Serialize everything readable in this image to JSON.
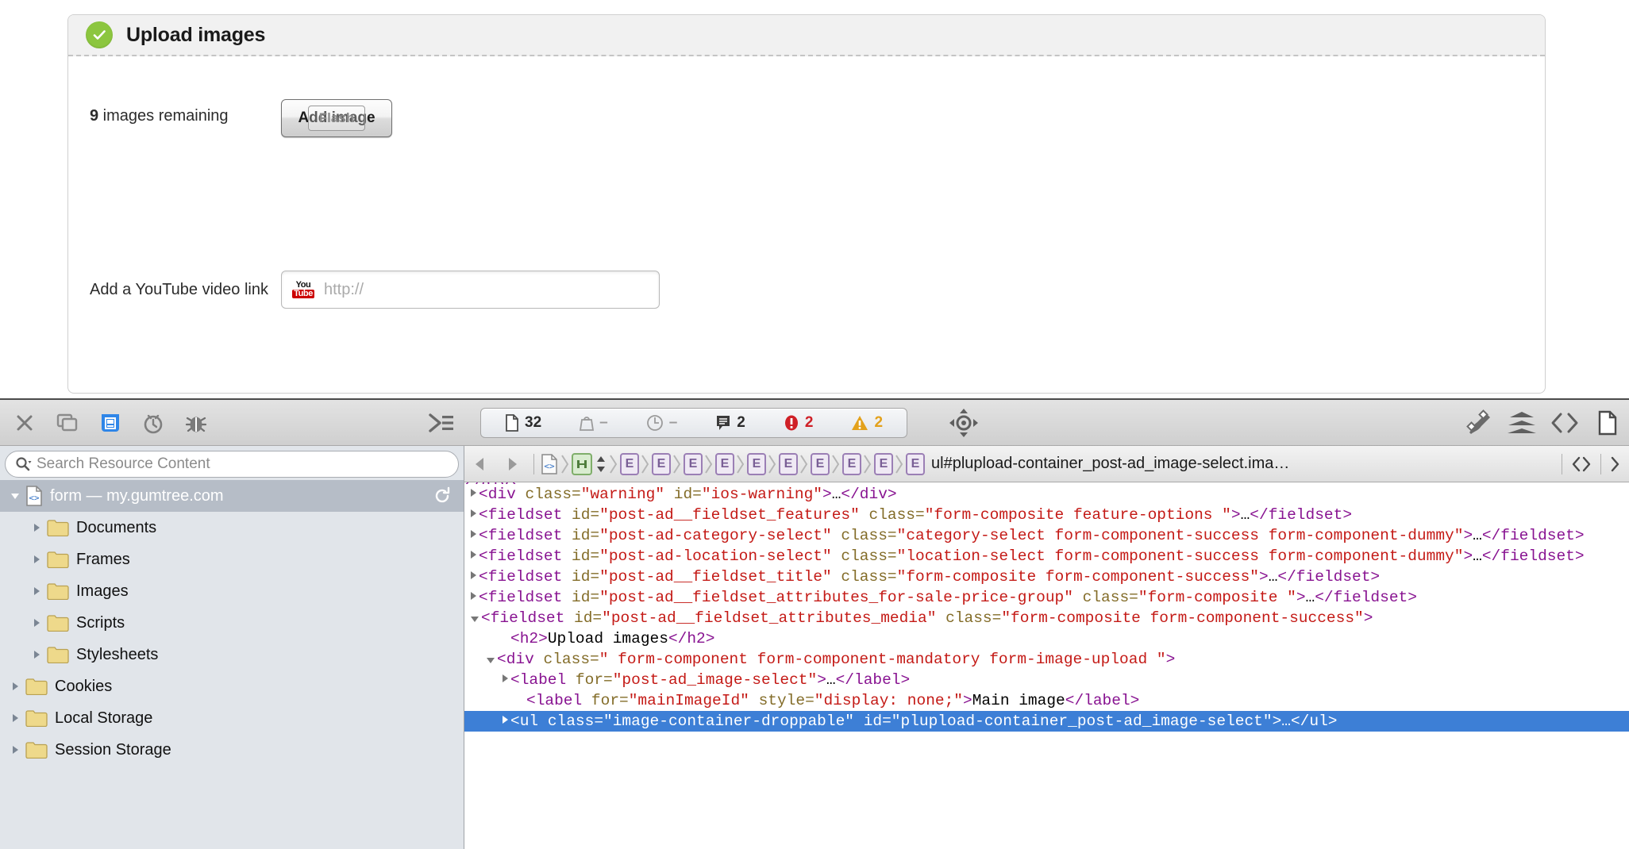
{
  "page": {
    "panel": {
      "title": "Upload images",
      "status_icon": "check-circle-icon",
      "status_color": "#8cc63f",
      "remaining_count": "9",
      "remaining_text": " images remaining",
      "add_image_label": "Add image",
      "flash_overlay_label": "Flash",
      "youtube_label": "Add a YouTube video link",
      "youtube_logo_top": "You",
      "youtube_logo_bottom": "Tube",
      "youtube_placeholder": "http://"
    }
  },
  "devtools": {
    "toolbar": {
      "left_icons": [
        {
          "name": "close-icon",
          "label": "Close"
        },
        {
          "name": "dock-window-icon",
          "label": "Undock"
        },
        {
          "name": "resources-panel-icon",
          "label": "Resources"
        },
        {
          "name": "timeline-clock-icon",
          "label": "Timeline"
        },
        {
          "name": "debugger-bug-icon",
          "label": "Debugger"
        }
      ],
      "console_toggle_icon": "console-prompt-icon",
      "stats": [
        {
          "name": "resource-count",
          "icon": "document-icon",
          "value": "32"
        },
        {
          "name": "resource-size",
          "icon": "weight-icon",
          "value": "–"
        },
        {
          "name": "load-time",
          "icon": "clock-icon",
          "value": "–"
        },
        {
          "name": "console-log-count",
          "icon": "message-icon",
          "value": "2"
        },
        {
          "name": "error-count",
          "icon": "error-icon",
          "value": "2",
          "color": "#cf2027"
        },
        {
          "name": "warning-count",
          "icon": "warning-icon",
          "value": "2",
          "color": "#e3a11b"
        }
      ],
      "right_icons": [
        {
          "name": "inspect-crosshair-icon",
          "label": "Inspect element"
        },
        {
          "name": "styles-brush-icon",
          "label": "Styles"
        },
        {
          "name": "layers-icon",
          "label": "Layers"
        },
        {
          "name": "code-brackets-icon",
          "label": "Source"
        },
        {
          "name": "document-node-icon",
          "label": "Node"
        }
      ]
    },
    "sidebar": {
      "search_placeholder": "Search Resource Content",
      "search_icon": "search-magnifier-icon",
      "reload_icon": "reload-arrow-icon",
      "tree": [
        {
          "label": "form — my.gumtree.com",
          "icon": "source-document-icon",
          "depth": 1,
          "expanded": true,
          "selected": true
        },
        {
          "label": "Documents",
          "icon": "folder-icon",
          "depth": 2,
          "expanded": false,
          "selected": false
        },
        {
          "label": "Frames",
          "icon": "folder-icon",
          "depth": 2,
          "expanded": false,
          "selected": false
        },
        {
          "label": "Images",
          "icon": "folder-icon",
          "depth": 2,
          "expanded": false,
          "selected": false
        },
        {
          "label": "Scripts",
          "icon": "folder-icon",
          "depth": 2,
          "expanded": false,
          "selected": false
        },
        {
          "label": "Stylesheets",
          "icon": "folder-icon",
          "depth": 2,
          "expanded": false,
          "selected": false
        },
        {
          "label": "Cookies",
          "icon": "folder-icon",
          "depth": 1,
          "expanded": false,
          "selected": false
        },
        {
          "label": "Local Storage",
          "icon": "folder-icon",
          "depth": 1,
          "expanded": false,
          "selected": false
        },
        {
          "label": "Session Storage",
          "icon": "folder-icon",
          "depth": 1,
          "expanded": false,
          "selected": false
        }
      ]
    },
    "breadcrumb": {
      "back_icon": "arrow-left-icon",
      "forward_icon": "arrow-right-icon",
      "document_badge": "<>",
      "frame_badge": "[ ]",
      "element_badge": "E",
      "element_badge_count": 10,
      "selected_label": "ul#plupload-container_post-ad_image-select.ima…",
      "right_icon_1": "code-brackets-icon",
      "right_icon_2": "sidebar-toggle-icon"
    },
    "dom": {
      "lines": [
        {
          "id": "l0",
          "indent": 0,
          "twisty": "none",
          "html": "<span class=\"tag\">‹/div›</span>",
          "partial": true
        },
        {
          "id": "l1",
          "indent": 1,
          "twisty": "closed",
          "html": "<span class=\"tag\">&lt;div</span> <span class=\"attr\">class=</span><span class=\"val\">\"warning\"</span> <span class=\"attr\">id=</span><span class=\"val\">\"ios-warning\"</span><span class=\"tag\">&gt;</span><span class=\"txt\">…</span><span class=\"tag\">&lt;/div&gt;</span>"
        },
        {
          "id": "l2",
          "indent": 1,
          "twisty": "closed",
          "html": "<span class=\"tag\">&lt;fieldset</span> <span class=\"attr\">id=</span><span class=\"val\">\"post-ad__fieldset_features\"</span> <span class=\"attr\">class=</span><span class=\"val\">\"form-composite feature-options \"</span><span class=\"tag\">&gt;</span><span class=\"txt\">…</span><span class=\"tag\">&lt;/fieldset&gt;</span>"
        },
        {
          "id": "l3",
          "indent": 1,
          "twisty": "closed",
          "html": "<span class=\"tag\">&lt;fieldset</span> <span class=\"attr\">id=</span><span class=\"val\">\"post-ad-category-select\"</span> <span class=\"attr\">class=</span><span class=\"val\">\"category-select form-component-success form-component-dummy\"</span><span class=\"tag\">&gt;</span><span class=\"txt\">…</span><span class=\"tag\">&lt;/fieldset&gt;</span>"
        },
        {
          "id": "l4",
          "indent": 1,
          "twisty": "closed",
          "html": "<span class=\"tag\">&lt;fieldset</span> <span class=\"attr\">id=</span><span class=\"val\">\"post-ad-location-select\"</span> <span class=\"attr\">class=</span><span class=\"val\">\"location-select form-component-success form-component-dummy\"</span><span class=\"tag\">&gt;</span><span class=\"txt\">…</span><span class=\"tag\">&lt;/fieldset&gt;</span>"
        },
        {
          "id": "l5",
          "indent": 1,
          "twisty": "closed",
          "html": "<span class=\"tag\">&lt;fieldset</span> <span class=\"attr\">id=</span><span class=\"val\">\"post-ad__fieldset_title\"</span> <span class=\"attr\">class=</span><span class=\"val\">\"form-composite form-component-success\"</span><span class=\"tag\">&gt;</span><span class=\"txt\">…</span><span class=\"tag\">&lt;/fieldset&gt;</span>"
        },
        {
          "id": "l6",
          "indent": 1,
          "twisty": "closed",
          "html": "<span class=\"tag\">&lt;fieldset</span> <span class=\"attr\">id=</span><span class=\"val\">\"post-ad__fieldset_attributes_for-sale-price-group\"</span> <span class=\"attr\">class=</span><span class=\"val\">\"form-composite \"</span><span class=\"tag\">&gt;</span><span class=\"txt\">…</span><span class=\"tag\">&lt;/fieldset&gt;</span>"
        },
        {
          "id": "l7",
          "indent": 1,
          "twisty": "open",
          "html": "<span class=\"tag\">&lt;fieldset</span> <span class=\"attr\">id=</span><span class=\"val\">\"post-ad__fieldset_attributes_media\"</span> <span class=\"attr\">class=</span><span class=\"val\">\"form-composite form-component-success\"</span><span class=\"tag\">&gt;</span>"
        },
        {
          "id": "l8",
          "indent": 3,
          "twisty": "none",
          "html": "<span class=\"tag\">&lt;h2&gt;</span><span class=\"txt\">Upload images</span><span class=\"tag\">&lt;/h2&gt;</span>"
        },
        {
          "id": "l9",
          "indent": 2,
          "twisty": "open",
          "html": "<span class=\"tag\">&lt;div</span> <span class=\"attr\">class=</span><span class=\"val\">\" form-component form-component-mandatory form-image-upload \"</span><span class=\"tag\">&gt;</span>"
        },
        {
          "id": "l10",
          "indent": 3,
          "twisty": "closed",
          "html": "<span class=\"tag\">&lt;label</span> <span class=\"attr\">for=</span><span class=\"val\">\"post-ad_image-select\"</span><span class=\"tag\">&gt;</span><span class=\"txt\">…</span><span class=\"tag\">&lt;/label&gt;</span>"
        },
        {
          "id": "l11",
          "indent": 4,
          "twisty": "none",
          "html": "<span class=\"tag\">&lt;label</span> <span class=\"attr\">for=</span><span class=\"val\">\"mainImageId\"</span> <span class=\"attr\">style=</span><span class=\"val\">\"display: none;\"</span><span class=\"tag\">&gt;</span><span class=\"txt\">Main image</span><span class=\"tag\">&lt;/label&gt;</span>"
        },
        {
          "id": "l12",
          "indent": 3,
          "twisty": "closed",
          "selected": true,
          "html": "<span class=\"tag\">&lt;ul</span> <span class=\"attr\">class=</span><span class=\"val\">\"image-container-droppable\"</span> <span class=\"attr\">id=</span><span class=\"val\">\"plupload-container_post-ad_image-select\"</span><span class=\"tag\">&gt;</span><span class=\"txt\">…</span><span class=\"tag\">&lt;/ul&gt;</span>"
        }
      ]
    }
  }
}
